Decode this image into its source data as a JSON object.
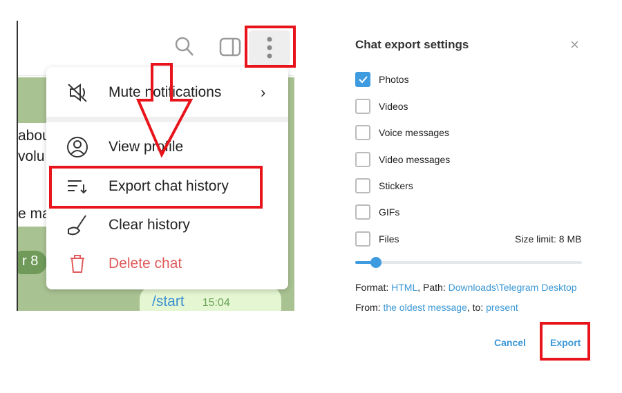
{
  "chat_header": {
    "icons": [
      "search-icon",
      "sidebar-toggle-icon",
      "more-vertical-icon"
    ]
  },
  "chat_fragments": [
    "abou",
    "volu",
    "e ma"
  ],
  "date_badge": "r 8",
  "message": {
    "text": "/start",
    "time": "15:04"
  },
  "menu": {
    "items": [
      {
        "label": "Mute notifications",
        "icon": "mute-icon",
        "has_submenu": true
      },
      {
        "label": "View profile",
        "icon": "profile-icon"
      },
      {
        "label": "Export chat history",
        "icon": "export-icon"
      },
      {
        "label": "Clear history",
        "icon": "broom-icon"
      },
      {
        "label": "Delete chat",
        "icon": "trash-icon",
        "color": "#e05a5a"
      }
    ]
  },
  "dialog": {
    "title": "Chat export settings",
    "options": [
      {
        "label": "Photos",
        "checked": true
      },
      {
        "label": "Videos",
        "checked": false
      },
      {
        "label": "Voice messages",
        "checked": false
      },
      {
        "label": "Video messages",
        "checked": false
      },
      {
        "label": "Stickers",
        "checked": false
      },
      {
        "label": "GIFs",
        "checked": false
      },
      {
        "label": "Files",
        "checked": false
      }
    ],
    "size_limit": "Size limit: 8 MB",
    "size_slider_fraction": 0.09,
    "format_label": "Format: ",
    "format_value": "HTML",
    "path_label": ", Path: ",
    "path_value": "Downloads\\Telegram Desktop",
    "from_label": "From: ",
    "from_value": "the oldest message",
    "to_label": ", to: ",
    "to_value": "present",
    "cancel": "Cancel",
    "export": "Export"
  },
  "colors": {
    "accent": "#3f9be0",
    "highlight": "#e8141c",
    "danger": "#e05a5a"
  }
}
